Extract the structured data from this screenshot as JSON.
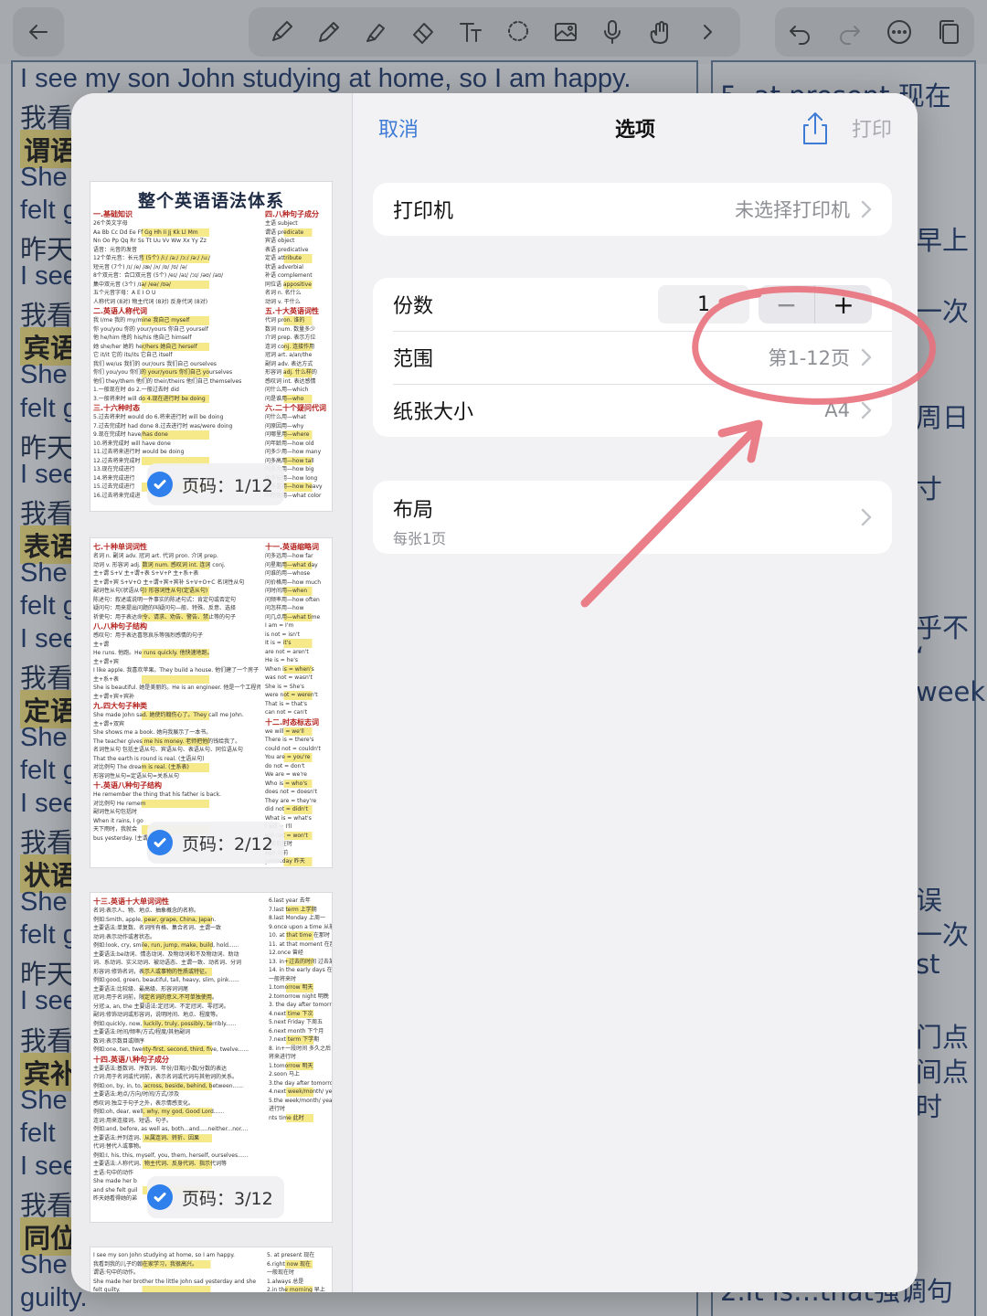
{
  "toolbar": {
    "left": [
      "back-arrow-icon"
    ],
    "tools": [
      "pen-icon",
      "pencil-icon",
      "highlighter-icon",
      "eraser-icon",
      "text-tool-icon",
      "lasso-icon",
      "image-icon",
      "microphone-icon",
      "hand-draw-icon",
      "chevron-right-icon"
    ],
    "right": [
      "undo-icon",
      "redo-icon",
      "more-icon",
      "pages-icon"
    ]
  },
  "background_left": {
    "lines": [
      {
        "text": "I see my son John studying at home, so I am happy.",
        "kind": "en"
      },
      {
        "text": "我看",
        "kind": "zh"
      },
      {
        "text": "谓语",
        "kind": "tag"
      },
      {
        "text": "She",
        "kind": "en"
      },
      {
        "text": "felt g",
        "kind": "en"
      },
      {
        "text": "昨天",
        "kind": "zh"
      },
      {
        "text": "I see",
        "kind": "en"
      },
      {
        "text": "我看",
        "kind": "zh"
      },
      {
        "text": "宾语",
        "kind": "tag"
      },
      {
        "text": "She",
        "kind": "en"
      },
      {
        "text": "felt g",
        "kind": "en"
      },
      {
        "text": "昨天",
        "kind": "zh"
      },
      {
        "text": "I see",
        "kind": "en"
      },
      {
        "text": "我看",
        "kind": "zh"
      },
      {
        "text": "表语",
        "kind": "tag"
      },
      {
        "text": "She",
        "kind": "en"
      },
      {
        "text": "felt g",
        "kind": "en"
      },
      {
        "text": "I see",
        "kind": "en"
      },
      {
        "text": "我看",
        "kind": "zh"
      },
      {
        "text": "定语",
        "kind": "tag"
      },
      {
        "text": "She",
        "kind": "en"
      },
      {
        "text": "felt g",
        "kind": "en"
      },
      {
        "text": "I see",
        "kind": "en"
      },
      {
        "text": "我看",
        "kind": "zh"
      },
      {
        "text": "状语",
        "kind": "tag"
      },
      {
        "text": "She",
        "kind": "en"
      },
      {
        "text": "felt g",
        "kind": "en"
      },
      {
        "text": "昨天",
        "kind": "zh"
      },
      {
        "text": "I see",
        "kind": "en"
      },
      {
        "text": "我看",
        "kind": "zh"
      },
      {
        "text": "宾补",
        "kind": "tag"
      },
      {
        "text": "She",
        "kind": "en"
      },
      {
        "text": "felt",
        "kind": "en"
      },
      {
        "text": "I see",
        "kind": "en"
      },
      {
        "text": "我看",
        "kind": "zh"
      },
      {
        "text": "同位",
        "kind": "tag"
      },
      {
        "text": "She r",
        "kind": "en"
      },
      {
        "text": "guilty.",
        "kind": "en"
      }
    ]
  },
  "background_right": {
    "lines": [
      "5. at present 现在",
      "早上",
      "一次",
      "周日",
      "寸",
      "乎不",
      "ʻ",
      "week",
      "误",
      "一次",
      "st",
      "门点",
      "间点",
      "时",
      "2.It is…that强调句"
    ]
  },
  "dialog": {
    "cancel": "取消",
    "title": "选项",
    "share_icon": "share-icon",
    "print": "打印",
    "printer": {
      "label": "打印机",
      "value": "未选择打印机"
    },
    "copies": {
      "label": "份数",
      "value": "1",
      "minus": "−",
      "plus": "+"
    },
    "range": {
      "label": "范围",
      "value": "第1-12页"
    },
    "paper": {
      "label": "纸张大小",
      "value": "A4"
    },
    "layout": {
      "label": "布局",
      "sub": "每张1页"
    },
    "colors": {
      "accent": "#3d7bd6",
      "check": "#2f80ed",
      "annotation": "#e8707c"
    }
  },
  "pages": [
    {
      "badge": "页码：1/12",
      "title": "整个英语语法体系",
      "sections_left": [
        "一.基础知识",
        "二.英语人称代词",
        "三.十六种时态"
      ],
      "sections_right": [
        "四.八种句子成分",
        "五.十大英语词性",
        "六.二十个疑问代词"
      ],
      "lines_left": [
        "26个英文字母",
        "Aa Bb Cc Dd Ee Ff Gg Hh Ii Jj Kk Ll Mm",
        "Nn Oo Pp Qq Rr Ss Tt Uu Vv Ww Xx Yy Zz",
        "语音：元音的发音",
        "12个单元音：长元音 (5个) /i:/ /a:/ /ɔ:/ /ə:/ /u:/",
        "短元音 (7个) /ɪ/ /e/ /æ/ /ʌ/ /ɒ/ /ʊ/ /ə/",
        "8个双元音：合口双元音 (5个) /eɪ/ /aɪ/ /ɔɪ/ /əʊ/ /aʊ/",
        "集中双元音 (3个) /ɪə/ /eə/ /ʊə/",
        "五个元音字母：A E I O U",
        "人称代词 (8对)  物主代词 (8对)  反身代词 (8对)",
        "我 I/me  我的 my/mine  我自己 myself",
        "你 you/you  你的 your/yours  你自己 yourself",
        "他 he/him  他的 his/his  他自己 himself",
        "她 she/her  她的 her/hers  她自己 herself",
        "它 it/it  它的 its/its  它自己 itself",
        "我们 we/us  我们的 our/ours  我们自己 ourselves",
        "你们 you/you  你们的 your/yours  你们自己 yourselves",
        "他们 they/them  他们的 their/theirs  他们自己 themselves",
        "1.一般现在时 do  2.一般过去时 did",
        "3.一般将来时 will do  4.现在进行时 be doing",
        "5.过去将来时 would do  6.将来进行时 will be doing",
        "7.过去完成时 had done  8.过去进行时 was/were doing",
        "9.现在完成时  have/has done",
        "10.将来完成时  will have done",
        "11.过去将来进行时  would be doing",
        "12.过去将来完成时",
        "13.现在完成进行",
        "14.将来完成进行",
        "15.过去完成进行",
        "16.过去将来完成进"
      ],
      "lines_right": [
        "主语 subject",
        "谓语 predicate",
        "宾语 object",
        "表语 predicative",
        "定语 attribute",
        "状语 adverbial",
        "补语 complement",
        "同位语 appositive",
        "名词 n. 名什么",
        "动词 v. 干什么",
        "代词 pron. 谁的",
        "数词 num. 数量多少",
        "介词 prep. 表示方位",
        "连词 conj. 连接作用",
        "冠词 art. a/an/the",
        "副词 adv. 表达方式",
        "形容词 adj. 什么样的",
        "感叹词 int. 表达感情",
        "问什么用—which",
        "问是谁用—who",
        "问什么用—what",
        "问原因用—why",
        "问哪里用—where",
        "问年龄用—how old",
        "问多少用—how many",
        "问多高用—how tall",
        "问多大用—how big",
        "问多长用—how long",
        "问多重用—how heavy",
        "问颜色用—what color"
      ]
    },
    {
      "badge": "页码：2/12",
      "sections_left": [
        "七.十种单词词性",
        "八.八种句子结构",
        "九.四大句子种类",
        "十.英语八种句子结构"
      ],
      "sections_right": [
        "十一.英语缩略词",
        "十二.时态标志词"
      ],
      "lines_left": [
        "名词 n.  副词 adv.  冠词 art.  代词 pron.  介词 prep.",
        "动词 v.  形容词 adj.  数词 num.  感叹词 int.  连词 conj.",
        "主+谓 S+V  主+谓+表 S+V+P  主+系+表",
        "主+谓+宾 S+V+O  主+谓+宾+宾补 S+V+O+C  名词性从句",
        "副词性从句(状语从句)  形容词性从句(定语从句)",
        "陈述句：叙述或说明一件事实的陈述句式：肯定句或否定句",
        "疑问句：用来提出问题的叫疑问句—般、特殊、反意、选择",
        "祈使句：用于表达命令、请求、劝告、警告、禁止等的句子",
        "感叹句：用于表达喜怒哀乐等强烈感情的句子",
        "主+谓",
        "He runs. 他跑。He runs quickly. 他快速地跑。",
        "主+谓+宾",
        "I like apple. 我喜欢苹果。They build a house. 他们建了一个房子",
        "主+系+表",
        "She is beautiful. 她是美丽的。He is an engineer. 他是一个工程师",
        "主+谓+宾+宾补",
        "She made John sad. 她使约翰伤心了。They call me John.",
        "主+谓+双宾",
        "She shows me a book. 她向我展示了一本书。",
        "The teacher gives me his money. 老师把他的钱给我了。",
        "名词性从句 包括主语从句、宾语从句、表语从句、同位语从句",
        "That the earth is round is real. (主语从句)",
        "对比例句 The dream is real. (主系表)",
        "形容词性从句=定语从句=关系从句",
        "He remember the thing that his father is back.",
        "对比例句 He remem",
        "副词性从句包括时",
        "When it rains, I go",
        "天下雨时，我就会",
        "bus yesterday. (主谓"
      ],
      "lines_right": [
        "问多远用—how far",
        "问星期用—what day",
        "问谁的用—whose",
        "问价格用—how much",
        "问时间用—when",
        "问频率用—how often",
        "问怎样用—how",
        "问几点用—what time",
        "I am = I'm",
        "is not = isn't",
        "It is = it's",
        "are not = aren't",
        "He is = he's",
        "When is = when's",
        "was not = wasn't",
        "She is = She's",
        "were not = weren't",
        "That is = that's",
        "can not = can't",
        "we will = we'll",
        "There is = there's",
        "could not = couldn't",
        "You are = you're",
        "do not = don't",
        "We are = we're",
        "Who is = who's",
        "does not = doesn't",
        "They are = they're",
        "did not = didn't",
        "What is = what's",
        "I will = I'll",
        "will not = won't",
        "一般现在时",
        "ago 以前",
        "yesterday 昨天",
        "day before",
        "day 前天",
        "time 上次"
      ]
    },
    {
      "badge": "页码：3/12",
      "sections_left": [
        "十三.英语十大单词词性",
        "十四.英语八种句子成分"
      ],
      "sections_right": [],
      "lines_left": [
        "名词:表示人、物、地点、抽象概念的名称。",
        "例如:Smith, apple, pear, grape, China, Japan.",
        "主要语法:单复数、名词所有格、集合名词、主谓一致",
        "动词:表示动作或者状态。",
        "例如:look, cry, smile, run, jump, make, build, hold......",
        "主要语法:be动词、情态动词、及物动词和不及物动词、助动",
        "词、系动词、实义动词、被动语态、主谓一致、动名词、分词",
        "形容词:修饰名词，表示人或事物的性质或特征。",
        "例如:good, green, beautiful, tall, heavy, slim, pink......",
        "主要语法:比较级、最高级、形容词词尾",
        "冠词:用于名词前，限定名词的意义,不可单独使用。",
        "分冠:a, an, the 主要语法:定冠词、不定冠词、零冠词。",
        "副词:修饰动词或形容词，说明时间、地点、程度等。",
        "例如:quickly, now, luckily, truly, possibly, terribly......",
        "主要语法:时间/频率/方式/程度/其他副词",
        "数词:表示数目或顺序",
        "例如:one, ten, twenty-first, second, third, five, twelve......",
        "主要语法:基数词、序数词、年份/日期/小数/分数的表达",
        "介词:用于名词或代词前，表示名词或代词与其他词的关系。",
        "例如:on, by, in, to, across, beside, behind, between......",
        "主要语法:地点/方向/时间/方式/涉及",
        "感叹词:独立于句子之外，表示情感变化。",
        "例如:oh, dear, well, why, my god, Good Lord......",
        "连词:用来连接词、短语、句子。",
        "例如:and, before, as well as, both...and.....neither...nor....",
        "主要语法:并列连词、从属连词、转折、因果",
        "代词:替代人或事物。",
        "例如:I, his, this, myself, you, them, herself, ourselves......",
        "主要语法:人称代词、物主代词、反身代词、指示代词等",
        "主语:句中的动作",
        "She made her b",
        "and she felt guil",
        "昨天她看得她的弟"
      ],
      "lines_right": [
        "6.last year 去年",
        "7.last term 上学期",
        "8.last Monday 上周一",
        "9.once upon a time 从前",
        "10. at that time 在那时",
        "11. at that moment 在那时",
        "12.once 曾经",
        "13. in+过去的时间 过去某时",
        "14. in the early days 在早期",
        "一般将来时",
        "1.tomorrow 明天",
        "2.tomorrow night 明晚",
        "3. the day after tomorrow 后天",
        "4.next time 下次",
        "5.next Friday 下周五",
        "6.next month 下个月",
        "7.next term 下学期",
        "8. in+一段时间 多久之后",
        "将来进行时",
        "1.tomorrow 明天",
        "2.soon 马上",
        "3.the day after tomorrow 后天",
        "4.next week/month/ year/... 下周/月/年",
        "5.the week/month/ year 那周/月/年",
        "进行时",
        "nts time 此时"
      ]
    },
    {
      "badge": "",
      "lines_left": [
        "I see my son John studying at home, so I am happy.",
        "我看到我的儿子约翰在家学习，我很高兴。",
        "谓语:句中的动作。",
        "She made her brother the little John sad yesterday and she",
        "felt guilty."
      ],
      "lines_right": [
        "5. at present 现在",
        "6.right now 现在",
        "一般现在时",
        "1.always 总是",
        "2.in the morning 早上"
      ]
    }
  ],
  "annotation": {
    "shape": "circle-and-arrow",
    "target": "range"
  }
}
